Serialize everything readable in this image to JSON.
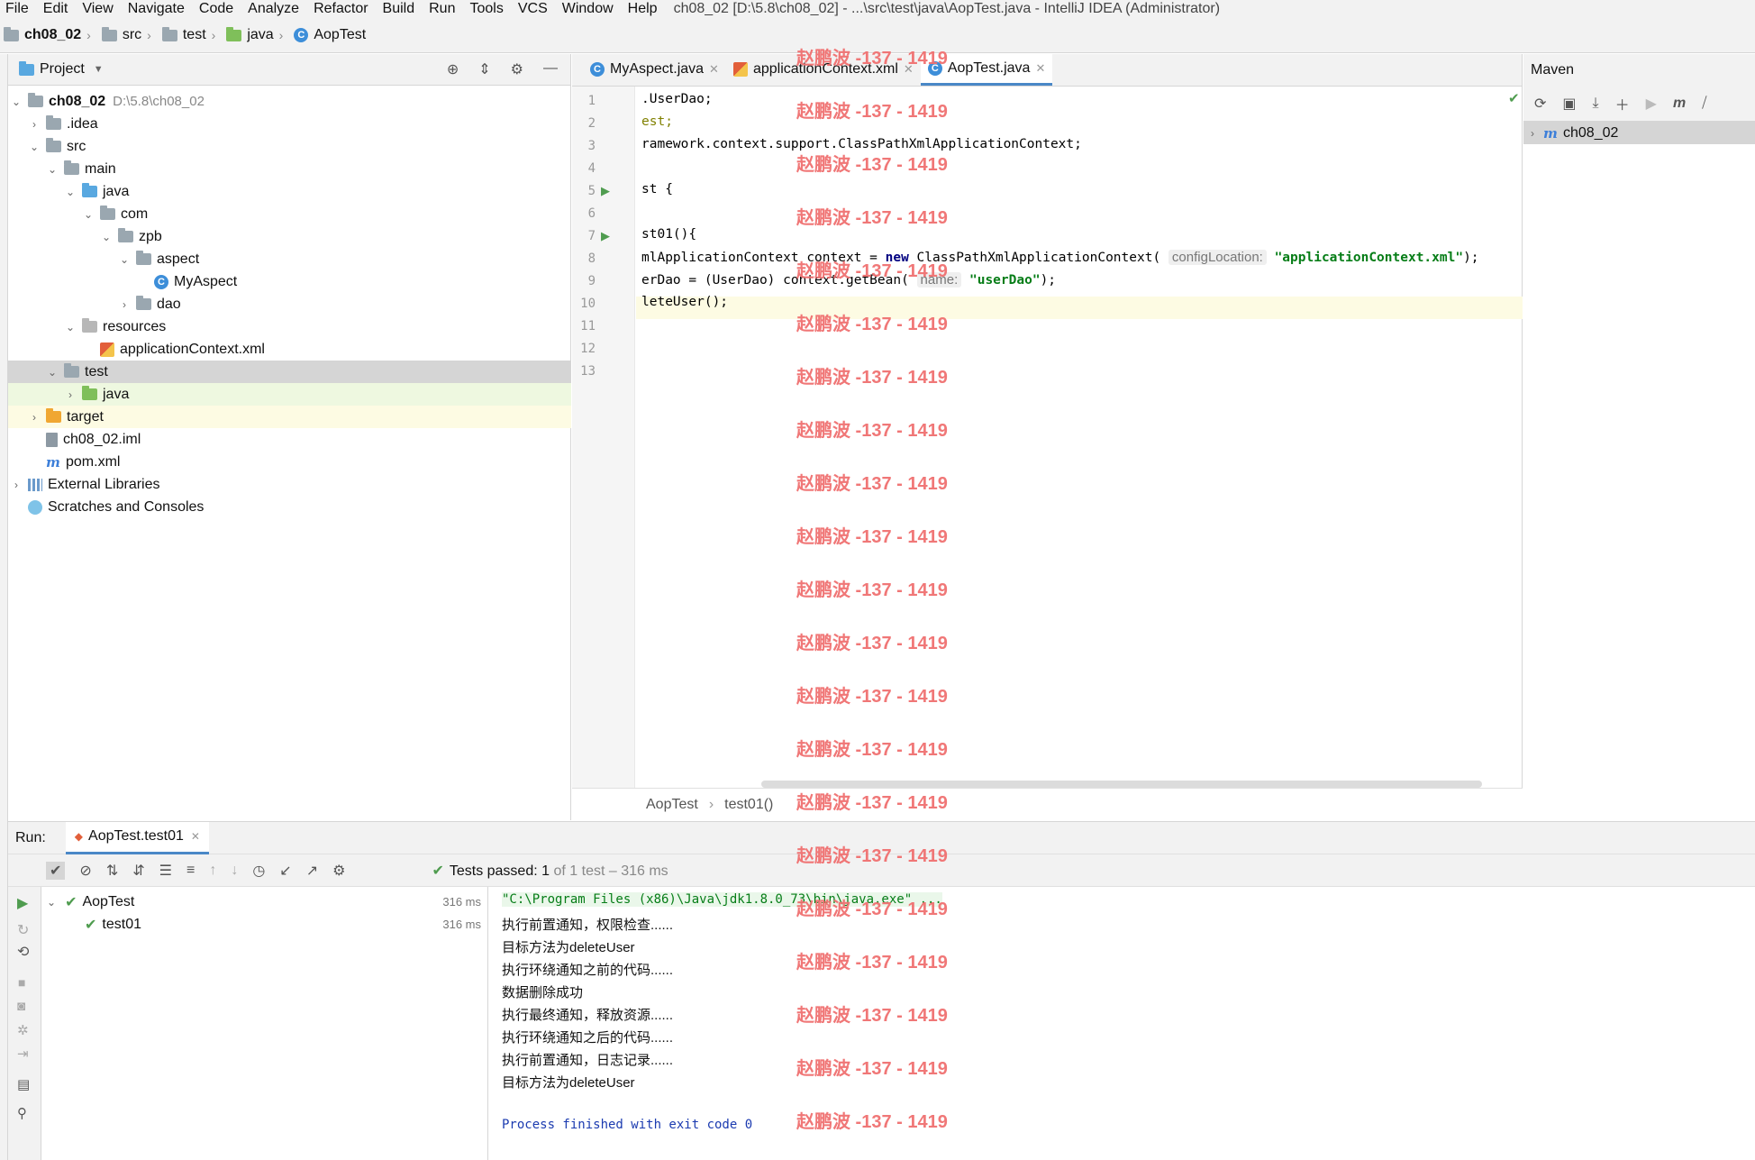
{
  "menu": {
    "items": [
      "File",
      "Edit",
      "View",
      "Navigate",
      "Code",
      "Analyze",
      "Refactor",
      "Build",
      "Run",
      "Tools",
      "VCS",
      "Window",
      "Help"
    ],
    "window_title": "ch08_02 [D:\\5.8\\ch08_02] - ...\\src\\test\\java\\AopTest.java - IntelliJ IDEA (Administrator)"
  },
  "breadcrumb": [
    "ch08_02",
    "src",
    "test",
    "java",
    "AopTest"
  ],
  "project_panel": {
    "title": "Project",
    "tree": [
      {
        "label": "ch08_02",
        "path": "D:\\5.8\\ch08_02"
      },
      {
        "label": ".idea"
      },
      {
        "label": "src"
      },
      {
        "label": "main"
      },
      {
        "label": "java"
      },
      {
        "label": "com"
      },
      {
        "label": "zpb"
      },
      {
        "label": "aspect"
      },
      {
        "label": "MyAspect"
      },
      {
        "label": "dao"
      },
      {
        "label": "resources"
      },
      {
        "label": "applicationContext.xml"
      },
      {
        "label": "test"
      },
      {
        "label": "java"
      },
      {
        "label": "target"
      },
      {
        "label": "ch08_02.iml"
      },
      {
        "label": "pom.xml"
      },
      {
        "label": "External Libraries"
      },
      {
        "label": "Scratches and Consoles"
      }
    ]
  },
  "editor": {
    "tabs": [
      "MyAspect.java",
      "applicationContext.xml",
      "AopTest.java"
    ],
    "active_tab": "AopTest.java",
    "line_numbers": [
      "1",
      "2",
      "3",
      "4",
      "5",
      "6",
      "7",
      "8",
      "9",
      "10",
      "11",
      "12",
      "13"
    ],
    "lines": {
      "l1": ".UserDao;",
      "l2": "est;",
      "l3": "ramework.context.support.ClassPathXmlApplicationContext;",
      "l5": "st {",
      "l7": "st01(){",
      "l8a": "mlApplicationContext context = ",
      "l8kw": "new",
      "l8b": " ClassPathXmlApplicationContext( ",
      "l8hint": "configLocation:",
      "l8str": "\"applicationContext.xml\"",
      "l8c": ");",
      "l9a": "erDao = (UserDao) context.getBean( ",
      "l9hint": "name:",
      "l9str": "\"userDao\"",
      "l9c": ");",
      "l10": "leteUser();"
    },
    "status_crumbs": [
      "AopTest",
      "test01()"
    ]
  },
  "maven": {
    "title": "Maven",
    "project": "ch08_02"
  },
  "run": {
    "label": "Run:",
    "tab": "AopTest.test01",
    "status_prefix": "Tests passed:",
    "status_count": "1",
    "status_suffix": "of 1 test – 316 ms",
    "tree": [
      {
        "label": "AopTest",
        "time": "316 ms"
      },
      {
        "label": "test01",
        "time": "316 ms"
      }
    ],
    "console": [
      "\"C:\\Program Files (x86)\\Java\\jdk1.8.0_73\\bin\\java.exe\" ...",
      "执行前置通知，权限检查......",
      "目标方法为deleteUser",
      "执行环绕通知之前的代码......",
      "数据删除成功",
      "执行最终通知，释放资源......",
      "执行环绕通知之后的代码......",
      "执行前置通知，日志记录......",
      "目标方法为deleteUser",
      "",
      "Process finished with exit code 0"
    ]
  },
  "watermark": "赵鹏波 -137 - 1419",
  "colors": {
    "accent": "#4a88c7",
    "success": "#4f9c4f",
    "string": "#067d17",
    "keyword": "#000080",
    "watermark": "#f07070"
  }
}
